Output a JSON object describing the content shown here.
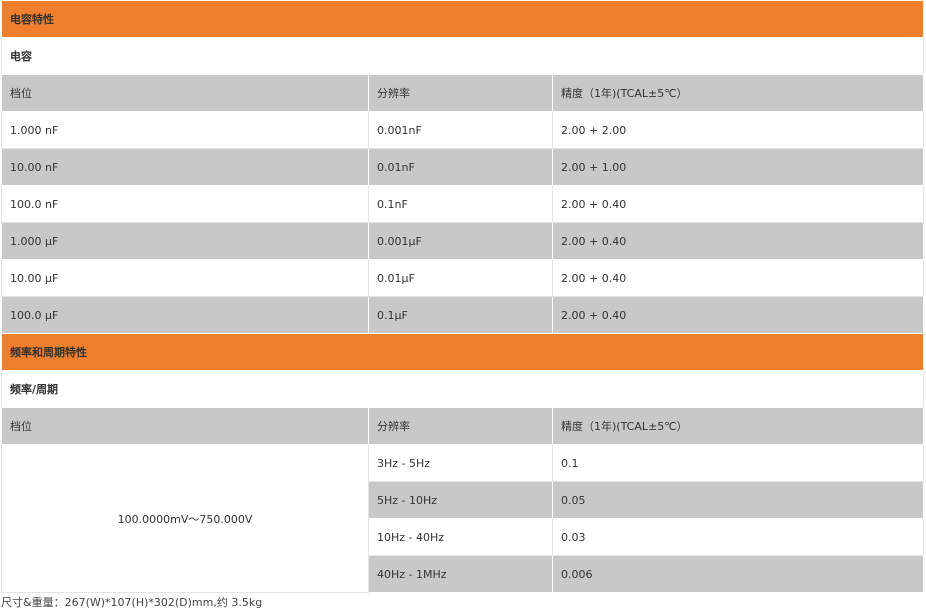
{
  "capacitance": {
    "section_title": "电容特性",
    "subtitle": "电容",
    "headers": [
      "档位",
      "分辨率",
      "精度（1年)(TCAL±5℃）"
    ],
    "rows": [
      {
        "range": "1.000 nF",
        "resolution": "0.001nF",
        "accuracy": "2.00 + 2.00"
      },
      {
        "range": "10.00 nF",
        "resolution": "0.01nF",
        "accuracy": "2.00 + 1.00"
      },
      {
        "range": "100.0 nF",
        "resolution": "0.1nF",
        "accuracy": "2.00 + 0.40"
      },
      {
        "range": "1.000 μF",
        "resolution": "0.001μF",
        "accuracy": "2.00 + 0.40"
      },
      {
        "range": "10.00 μF",
        "resolution": "0.01μF",
        "accuracy": "2.00 + 0.40"
      },
      {
        "range": "100.0 μF",
        "resolution": "0.1μF",
        "accuracy": "2.00 + 0.40"
      }
    ]
  },
  "frequency": {
    "section_title": "频率和周期特性",
    "subtitle": "频率/周期",
    "headers": [
      "档位",
      "分辨率",
      "精度（1年)(TCAL±5℃）"
    ],
    "range": "100.0000mV～750.000V",
    "rows": [
      {
        "resolution": "3Hz - 5Hz",
        "accuracy": "0.1"
      },
      {
        "resolution": "5Hz - 10Hz",
        "accuracy": "0.05"
      },
      {
        "resolution": "10Hz - 40Hz",
        "accuracy": "0.03"
      },
      {
        "resolution": "40Hz - 1MHz",
        "accuracy": "0.006"
      }
    ]
  },
  "footer": "尺寸&重量：267(W)*107(H)*302(D)mm,约 3.5kg",
  "colors": {
    "section_bg": "#ef7f2c",
    "row_grey": "#c8c8c8",
    "row_white": "#ffffff"
  }
}
